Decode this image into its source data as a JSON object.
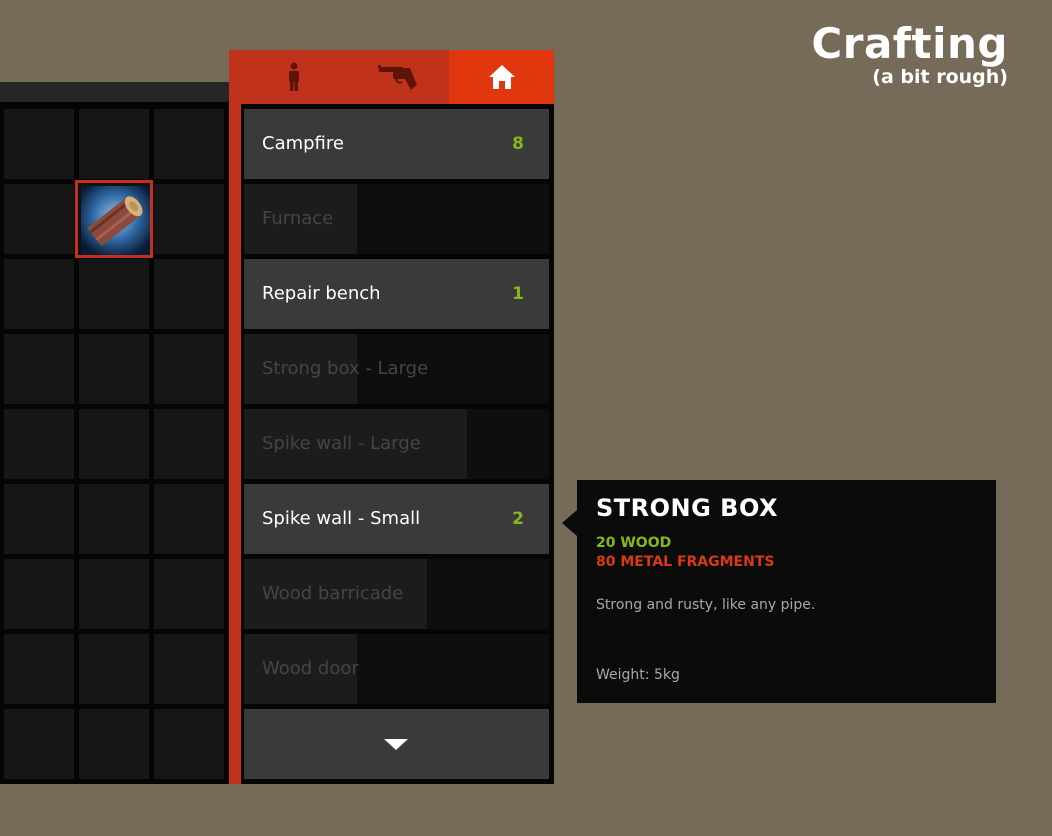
{
  "header": {
    "title": "Crafting",
    "subtitle": "(a bit rough)"
  },
  "inventory": {
    "columns": 3,
    "rows": 9,
    "selected_item": {
      "name": "log-item-icon"
    }
  },
  "tabs": [
    {
      "icon": "person-icon",
      "active": false
    },
    {
      "icon": "revolver-icon",
      "active": false
    },
    {
      "icon": "home-icon",
      "active": true
    }
  ],
  "recipes": [
    {
      "name": "Campfire",
      "count": "8",
      "available": true
    },
    {
      "name": "Furnace",
      "count": "",
      "available": false,
      "progress": 0.37
    },
    {
      "name": "Repair bench",
      "count": "1",
      "available": true
    },
    {
      "name": "Strong box - Large",
      "count": "",
      "available": false,
      "progress": 0.37
    },
    {
      "name": "Spike wall - Large",
      "count": "",
      "available": false,
      "progress": 0.73
    },
    {
      "name": "Spike wall - Small",
      "count": "2",
      "available": true
    },
    {
      "name": "Wood barricade",
      "count": "",
      "available": false,
      "progress": 0.6
    },
    {
      "name": "Wood door",
      "count": "",
      "available": false,
      "progress": 0.37
    }
  ],
  "scroll_icon": "chevron-down-icon",
  "tooltip": {
    "title": "STRONG BOX",
    "requirements": [
      "20 WOOD",
      "80 METAL FRAGMENTS"
    ],
    "description": "Strong and rusty, like any pipe.",
    "weight": "Weight: 5kg"
  },
  "colors": {
    "background": "#766a59",
    "accent": "#c0321b",
    "active_tab": "#e0370f",
    "available_green": "#86b81e",
    "missing_red": "#d83a16"
  }
}
